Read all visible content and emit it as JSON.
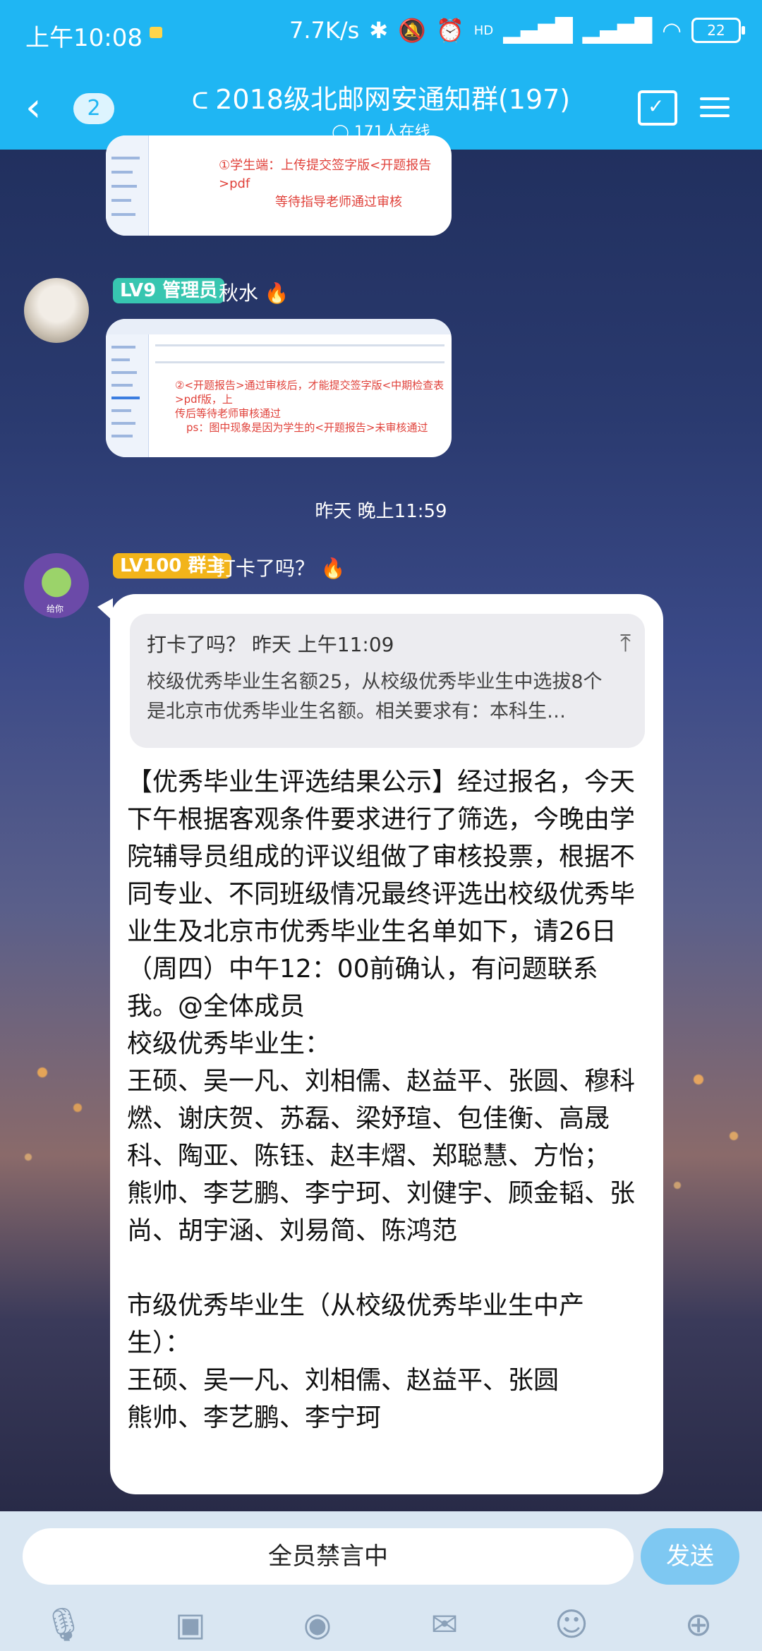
{
  "status_bar": {
    "time": "上午10:08",
    "network_speed": "7.7K/s",
    "hd_label": "HD",
    "battery": "22"
  },
  "header": {
    "unread_count": "2",
    "title": "2018级北邮网安通知群(197)",
    "online": "171人在线",
    "accent_color": "#1fb6f3"
  },
  "messages": {
    "top_image": {
      "note_line1": "①学生端：上传提交签字版<开题报告>pdf",
      "note_line2": "等待指导老师通过审核"
    },
    "admin": {
      "badge": "LV9 管理员",
      "name": "秋水",
      "image_note_line1": "②<开题报告>通过审核后，才能提交签字版<中期检查表>pdf版，上",
      "image_note_line2": "传后等待老师审核通过",
      "image_note_line3": "ps：图中现象是因为学生的<开题报告>未审核通过"
    },
    "timestamp": "昨天 晚上11:59",
    "owner": {
      "badge": "LV100 群主",
      "name": "打卡了吗？",
      "avatar_caption": "给你",
      "quote_header": "打卡了吗？  昨天 上午11:09",
      "quote_body": "校级优秀毕业生名额25，从校级优秀毕业生中选拔8个是北京市优秀毕业生名额。相关要求有：本科生…",
      "text": "【优秀毕业生评选结果公示】经过报名，今天下午根据客观条件要求进行了筛选，今晚由学院辅导员组成的评议组做了审核投票，根据不同专业、不同班级情况最终评选出校级优秀毕业生及北京市优秀毕业生名单如下，请26日（周四）中午12：00前确认，有问题联系我。@全体成员\n校级优秀毕业生：\n王硕、吴一凡、刘相儒、赵益平、张圆、穆科燃、谢庆贺、苏磊、梁妤瑄、包佳衡、高晟科、陶亚、陈钰、赵丰熠、郑聪慧、方怡；\n熊帅、李艺鹏、李宁珂、刘健宇、顾金韬、张尚、胡宇涵、刘易简、陈鸿范\n\n市级优秀毕业生（从校级优秀毕业生中产生）：\n王硕、吴一凡、刘相儒、赵益平、张圆\n熊帅、李艺鹏、李宁珂"
    }
  },
  "input": {
    "muted_label": "全员禁言中",
    "send_label": "发送"
  },
  "toolbar_icons": [
    "microphone-icon",
    "image-icon",
    "camera-icon",
    "red-packet-icon",
    "emoji-icon",
    "plus-icon"
  ]
}
